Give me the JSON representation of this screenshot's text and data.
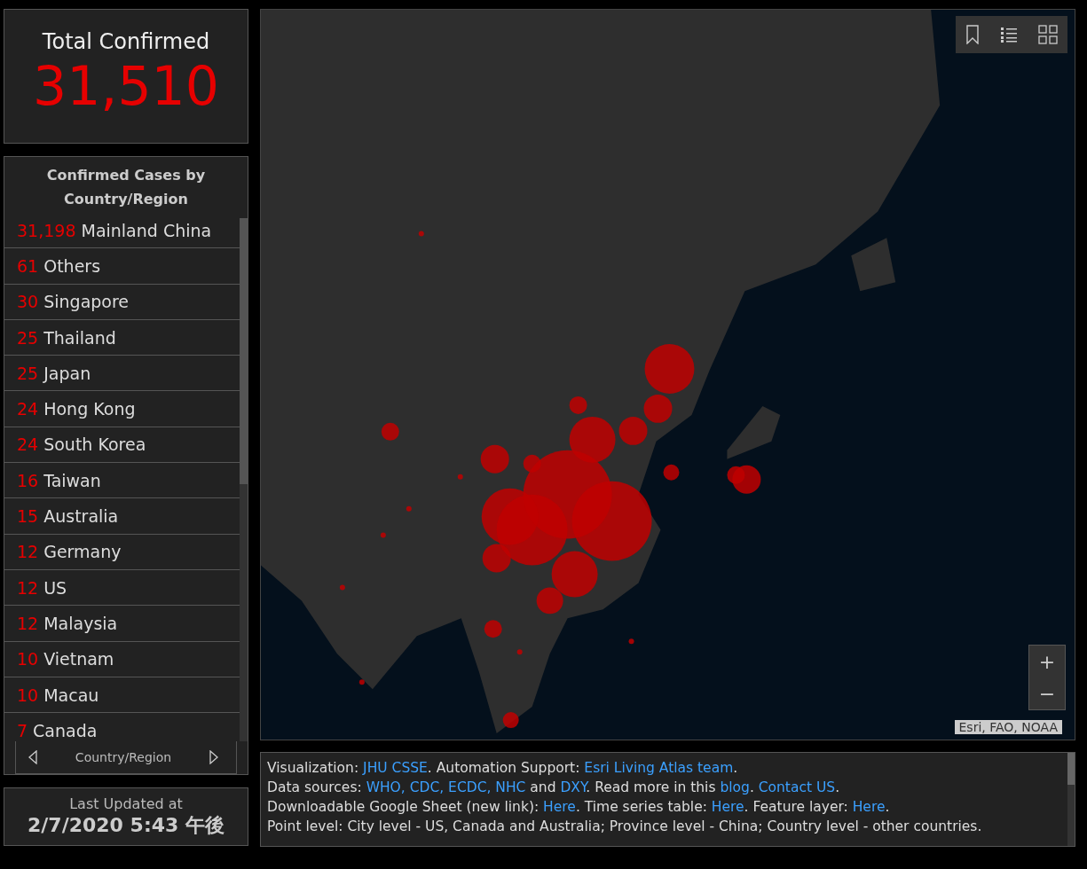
{
  "total": {
    "label": "Total Confirmed",
    "value": "31,510"
  },
  "country_list": {
    "title": "Confirmed Cases by Country/Region",
    "rows": [
      {
        "count": "31,198",
        "name": "Mainland China"
      },
      {
        "count": "61",
        "name": "Others"
      },
      {
        "count": "30",
        "name": "Singapore"
      },
      {
        "count": "25",
        "name": "Thailand"
      },
      {
        "count": "25",
        "name": "Japan"
      },
      {
        "count": "24",
        "name": "Hong Kong"
      },
      {
        "count": "24",
        "name": "South Korea"
      },
      {
        "count": "16",
        "name": "Taiwan"
      },
      {
        "count": "15",
        "name": "Australia"
      },
      {
        "count": "12",
        "name": "Germany"
      },
      {
        "count": "12",
        "name": "US"
      },
      {
        "count": "12",
        "name": "Malaysia"
      },
      {
        "count": "10",
        "name": "Vietnam"
      },
      {
        "count": "10",
        "name": "Macau"
      },
      {
        "count": "7",
        "name": "Canada"
      }
    ],
    "pager_label": "Country/Region"
  },
  "last_updated": {
    "label": "Last Updated at",
    "value": "2/7/2020 5:43 午後"
  },
  "map": {
    "zoom_in": "+",
    "zoom_out": "−",
    "attribution": "Esri, FAO, NOAA"
  },
  "footer": {
    "lines": [
      [
        {
          "text": "Visualization: ",
          "link": false
        },
        {
          "text": "JHU CSSE",
          "link": true
        },
        {
          "text": ". Automation Support: ",
          "link": false
        },
        {
          "text": "Esri Living Atlas team",
          "link": true
        },
        {
          "text": ".",
          "link": false
        }
      ],
      [
        {
          "text": "Data sources: ",
          "link": false
        },
        {
          "text": "WHO, CDC, ECDC, NHC",
          "link": true
        },
        {
          "text": " and ",
          "link": false
        },
        {
          "text": "DXY",
          "link": true
        },
        {
          "text": ". Read more in this ",
          "link": false
        },
        {
          "text": "blog",
          "link": true
        },
        {
          "text": ". ",
          "link": false
        },
        {
          "text": "Contact US",
          "link": true
        },
        {
          "text": ".",
          "link": false
        }
      ],
      [
        {
          "text": "Downloadable Google Sheet (new link): ",
          "link": false
        },
        {
          "text": "Here",
          "link": true
        },
        {
          "text": ". Time series table: ",
          "link": false
        },
        {
          "text": "Here",
          "link": true
        },
        {
          "text": ". Feature layer: ",
          "link": false
        },
        {
          "text": "Here",
          "link": true
        },
        {
          "text": ".",
          "link": false
        }
      ],
      [
        {
          "text": "Point level: City level - US, Canada and Australia; Province level - China; Country level - other countries.",
          "link": false
        }
      ]
    ]
  }
}
